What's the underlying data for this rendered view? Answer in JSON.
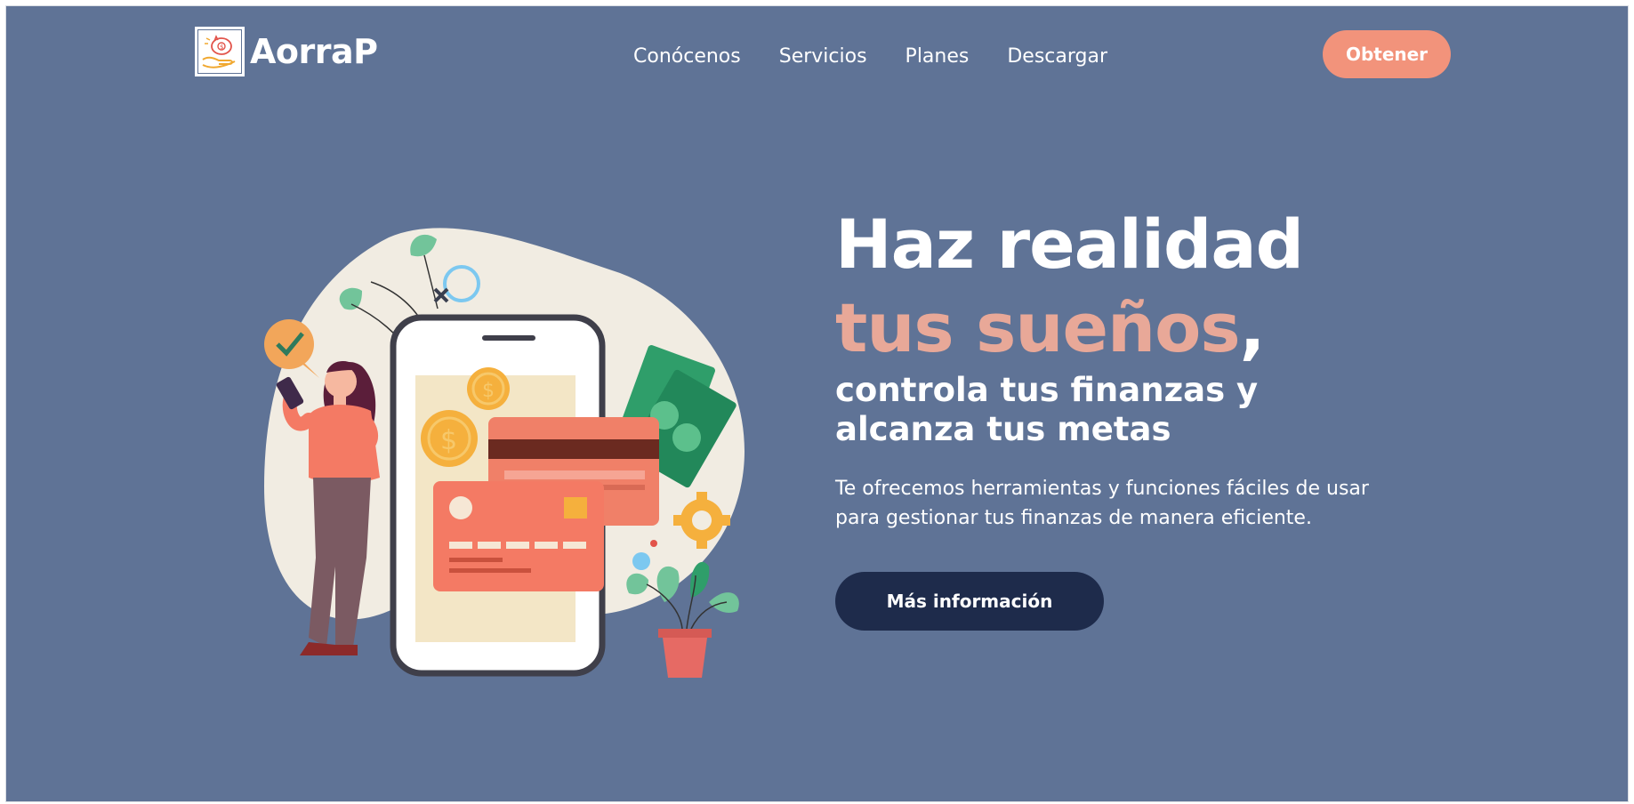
{
  "brand": {
    "name": "AorraP",
    "logo_icon": "piggy-bank-hand-icon"
  },
  "nav": {
    "items": [
      "Conócenos",
      "Servicios",
      "Planes",
      "Descargar"
    ],
    "cta_label": "Obtener"
  },
  "hero": {
    "title_line1": "Haz realidad",
    "title_line2_accent": "tus sueños",
    "title_line2_comma": ",",
    "subtitle_line1": "controla tus finanzas y",
    "subtitle_line2": "alcanza tus metas",
    "description_line1": "Te ofrecemos herramientas y funciones fáciles de usar",
    "description_line2": "para gestionar tus finanzas de manera eficiente.",
    "button_label": "Más información"
  },
  "colors": {
    "background": "#5f7396",
    "accent": "#f2937b",
    "accent_text": "#e8a898",
    "button_dark": "#1e2b4b"
  }
}
